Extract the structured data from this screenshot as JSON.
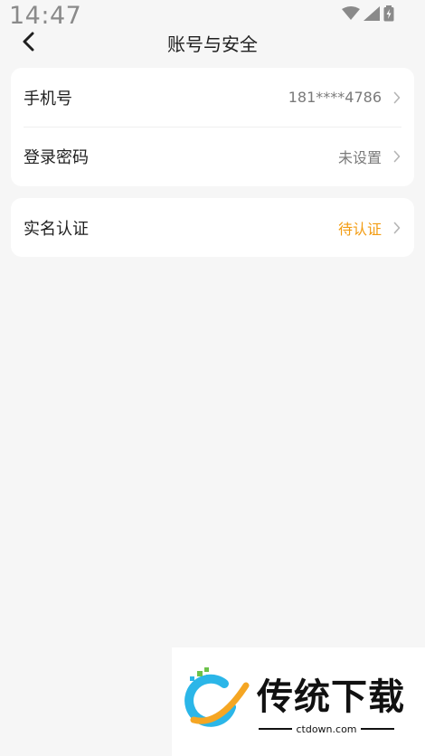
{
  "status": {
    "time": "14:47"
  },
  "header": {
    "title": "账号与安全"
  },
  "sections": [
    {
      "rows": [
        {
          "label": "手机号",
          "value": "181****4786"
        },
        {
          "label": "登录密码",
          "value": "未设置"
        }
      ]
    },
    {
      "rows": [
        {
          "label": "实名认证",
          "value": "待认证",
          "value_color": "#f39c12"
        }
      ]
    }
  ],
  "watermark": {
    "title": "传统下载",
    "subtitle": "ctdown.com"
  },
  "colors": {
    "background": "#f6f6f6",
    "card": "#ffffff",
    "pending": "#f39c12"
  }
}
